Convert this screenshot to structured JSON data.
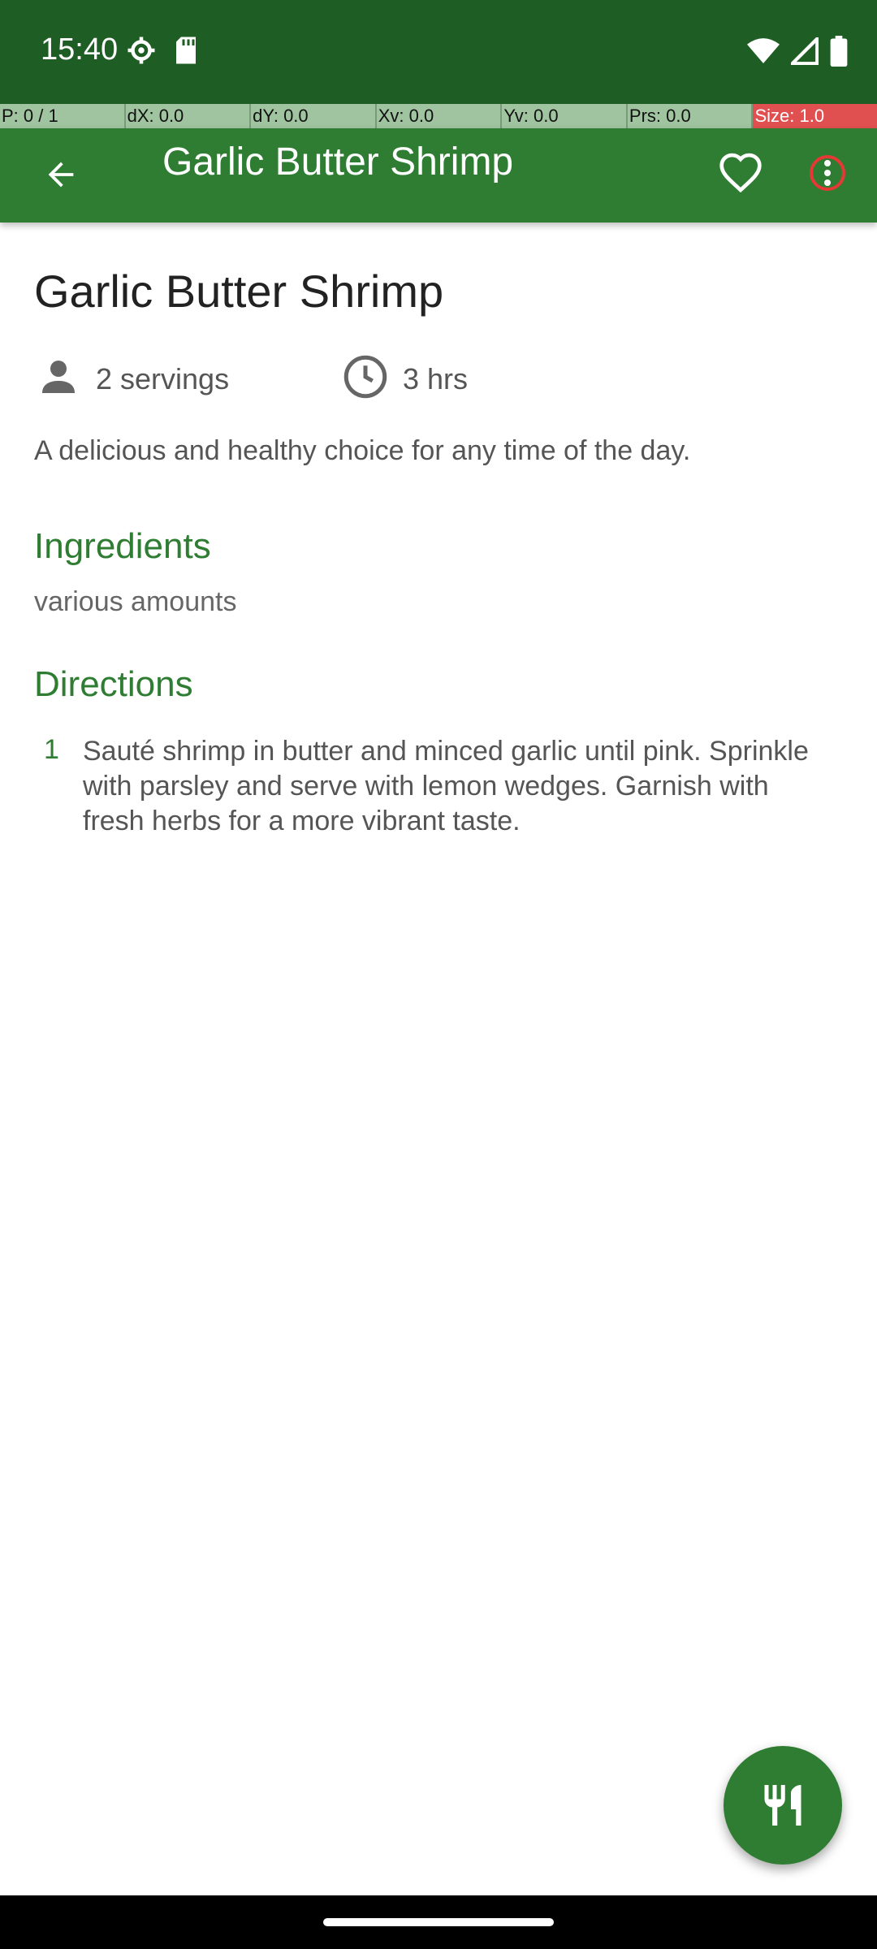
{
  "status_bar": {
    "time": "15:40",
    "left_icons": [
      "settings-icon",
      "sd-card-icon"
    ],
    "right_icons": [
      "wifi-icon",
      "signal-icon",
      "battery-icon"
    ]
  },
  "debug_overlay": {
    "cells": [
      "P: 0 / 1",
      "dX: 0.0",
      "dY: 0.0",
      "Xv: 0.0",
      "Yv: 0.0",
      "Prs: 0.0",
      "Size: 1.0"
    ]
  },
  "app_bar": {
    "title": "Garlic Butter Shrimp",
    "back_icon": "arrow-back-icon",
    "favorite_icon": "heart-outline-icon",
    "more_icon": "more-vert-icon"
  },
  "recipe": {
    "title": "Garlic Butter Shrimp",
    "servings": "2 servings",
    "time": "3 hrs",
    "description": "A delicious and healthy choice for any time of the day.",
    "ingredients_heading": "Ingredients",
    "ingredients": "various amounts",
    "directions_heading": "Directions",
    "directions": [
      {
        "number": "1",
        "text": "Sauté shrimp in butter and minced garlic until pink. Sprinkle with parsley and serve with lemon wedges. Garnish with fresh herbs for a more vibrant taste."
      }
    ]
  },
  "fab": {
    "icon": "restaurant-icon"
  },
  "colors": {
    "status_bar": "#1e5e25",
    "app_bar": "#2e7d32",
    "accent": "#2e7d32"
  }
}
